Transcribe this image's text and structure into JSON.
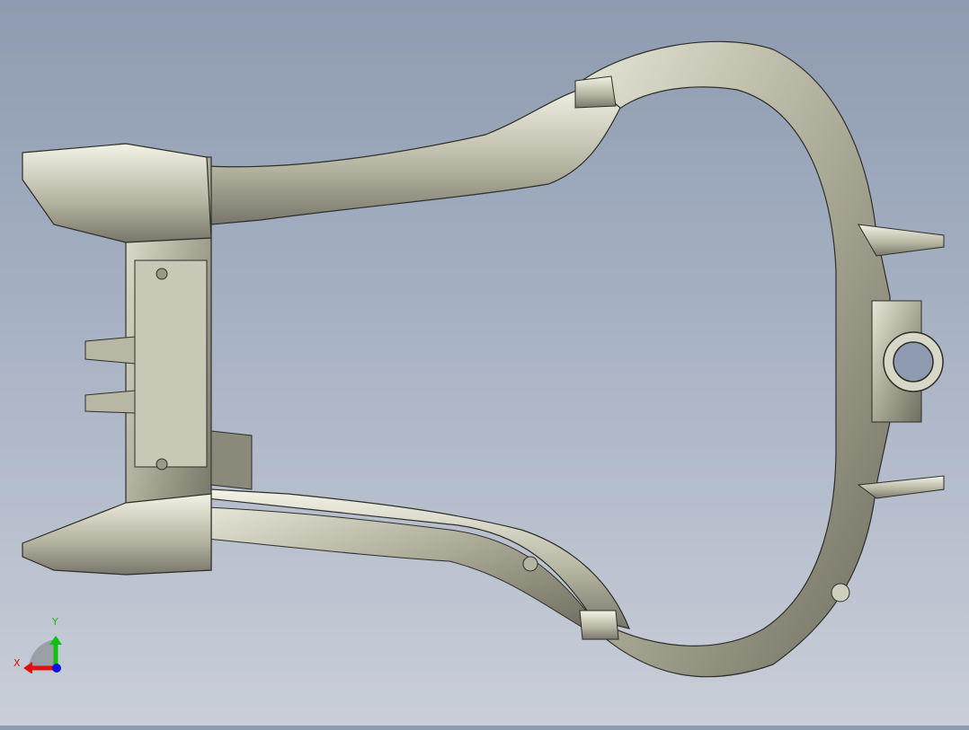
{
  "viewport": {
    "model": "subframe-part",
    "colors": {
      "background_top": "#8e9bb0",
      "background_bottom": "#c9ced8",
      "metal": "#c4c4b2",
      "edge": "#2e2e28"
    }
  },
  "triad": {
    "x_label": "X",
    "y_label": "Y",
    "colors": {
      "x": "#e01010",
      "y": "#10c010",
      "z": "#1010e0"
    }
  }
}
